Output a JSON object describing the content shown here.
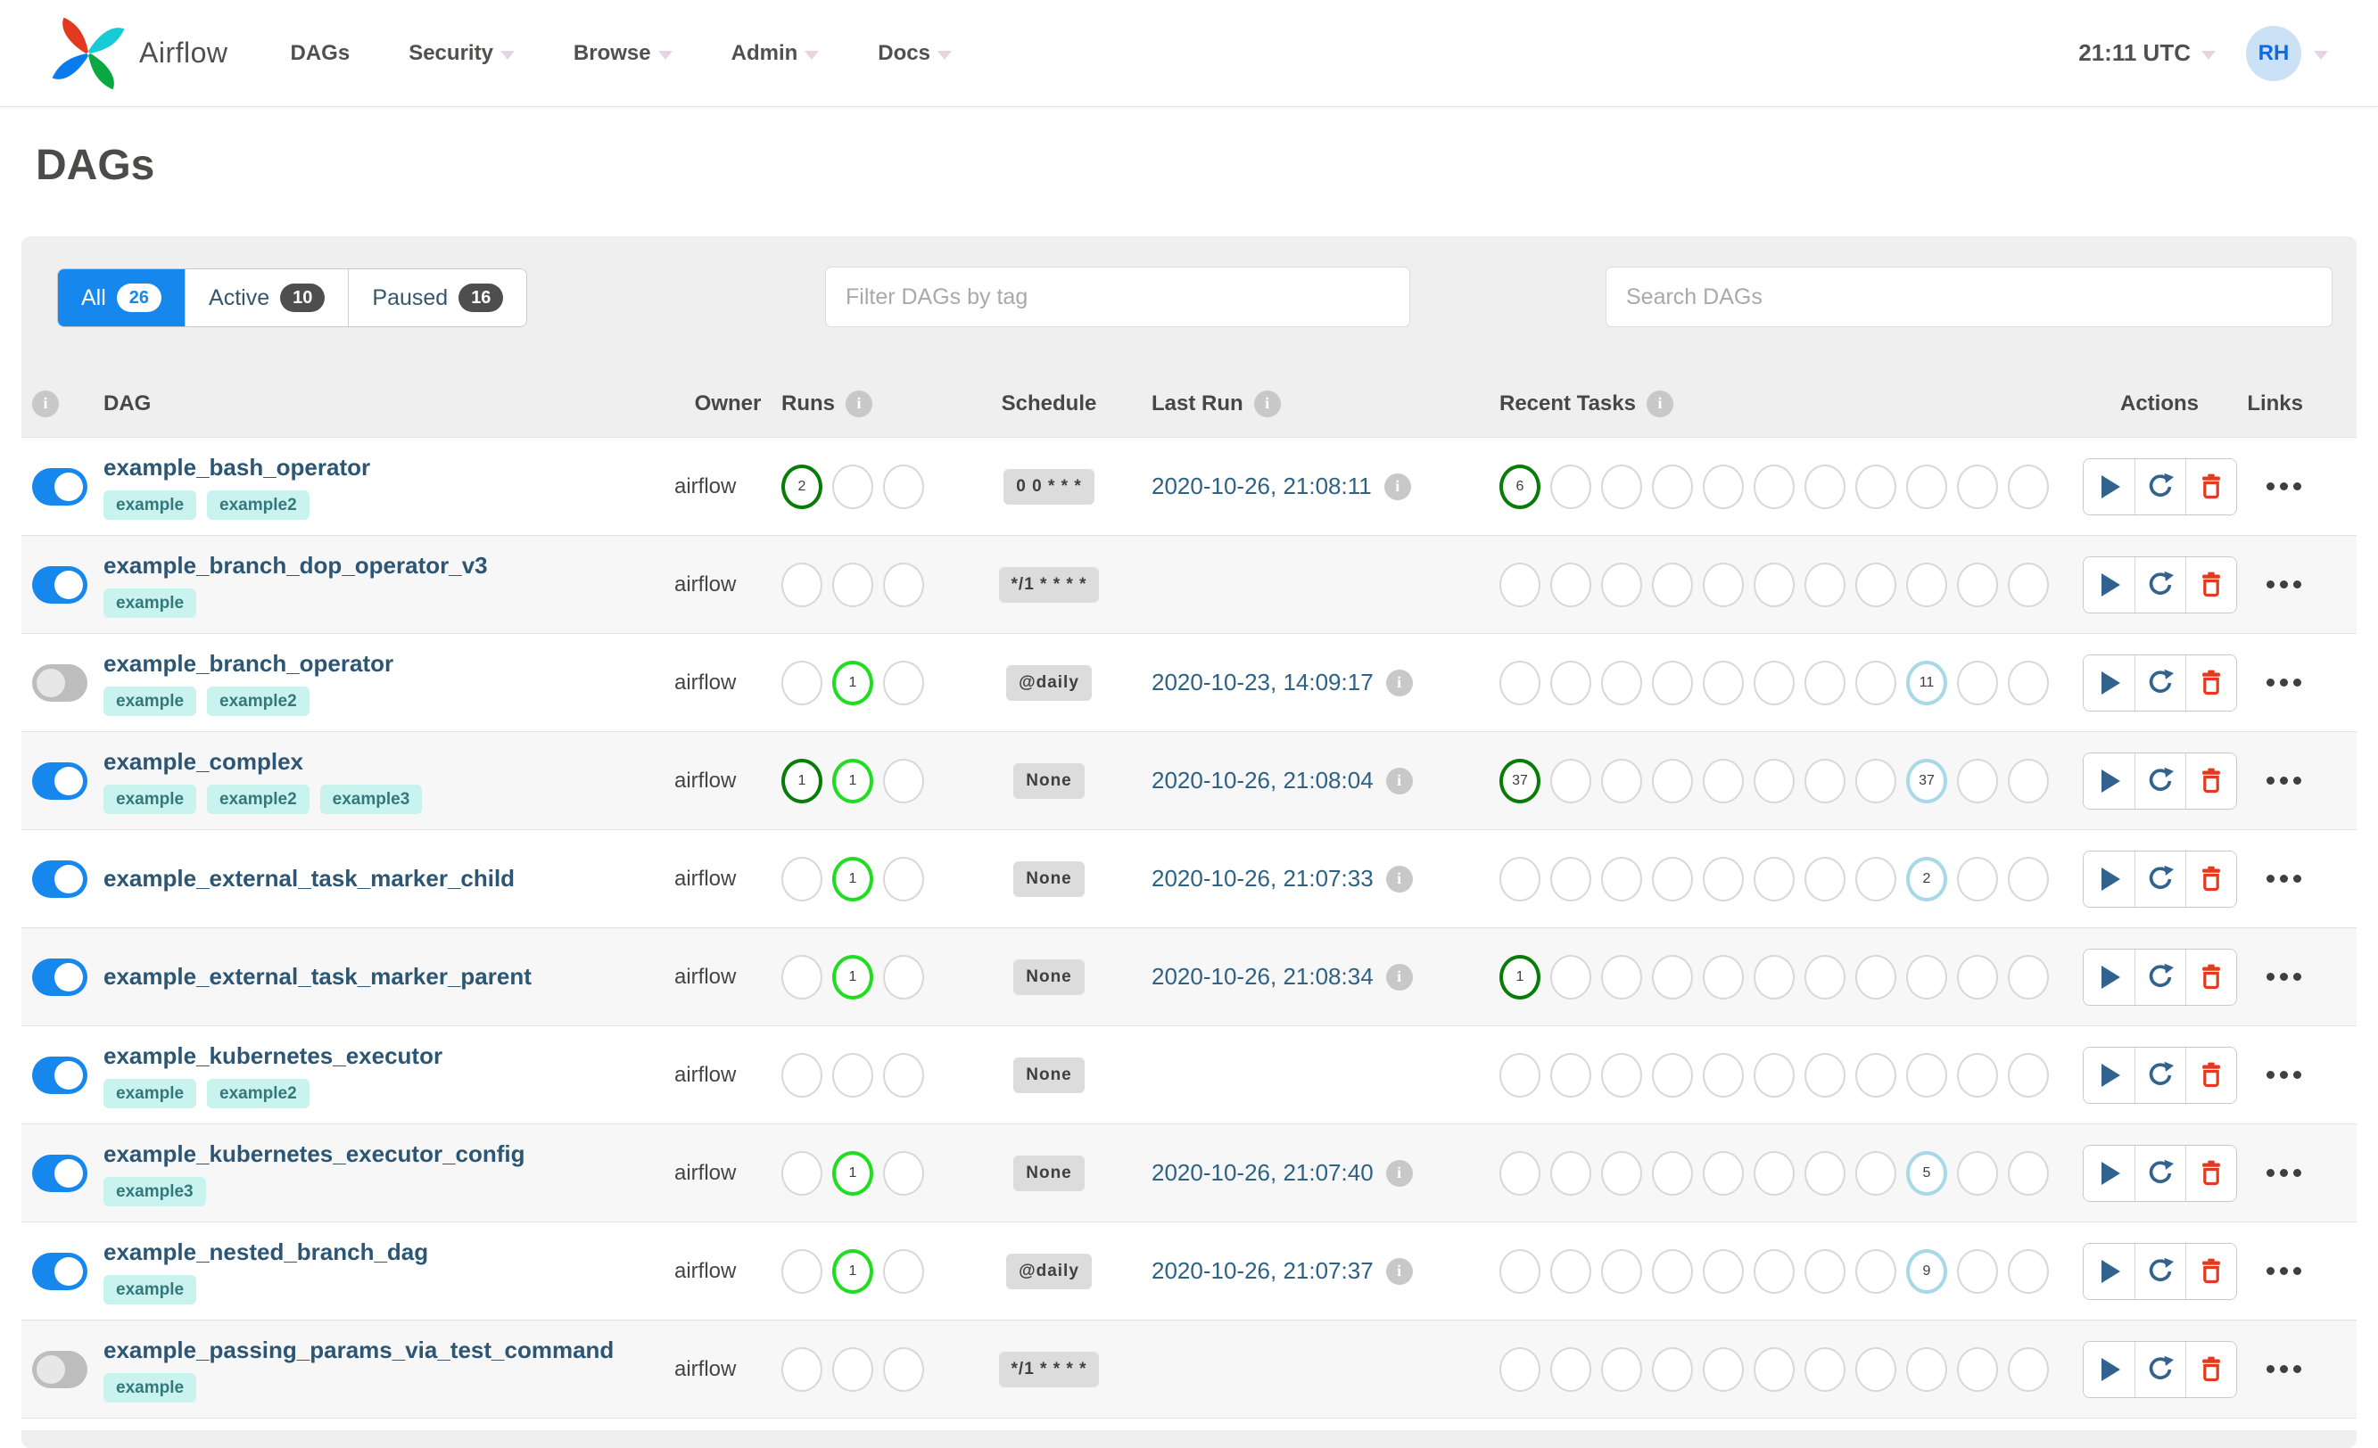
{
  "navbar": {
    "brand": "Airflow",
    "items": [
      {
        "label": "DAGs",
        "caret": false
      },
      {
        "label": "Security",
        "caret": true
      },
      {
        "label": "Browse",
        "caret": true
      },
      {
        "label": "Admin",
        "caret": true
      },
      {
        "label": "Docs",
        "caret": true
      }
    ],
    "clock": "21:11 UTC",
    "avatar_initials": "RH"
  },
  "page": {
    "title": "DAGs"
  },
  "filters": {
    "tabs": [
      {
        "label": "All",
        "count": "26",
        "active": true
      },
      {
        "label": "Active",
        "count": "10",
        "active": false
      },
      {
        "label": "Paused",
        "count": "16",
        "active": false
      }
    ],
    "tag_filter_placeholder": "Filter DAGs by tag",
    "search_placeholder": "Search DAGs"
  },
  "table": {
    "headers": {
      "dag": "DAG",
      "owner": "Owner",
      "runs": "Runs",
      "schedule": "Schedule",
      "last_run": "Last Run",
      "recent_tasks": "Recent Tasks",
      "actions": "Actions",
      "links": "Links"
    },
    "runs_slots": 3,
    "recent_slots": 11,
    "rows": [
      {
        "name": "example_bash_operator",
        "enabled": true,
        "tags": [
          "example",
          "example2"
        ],
        "owner": "airflow",
        "runs": [
          {
            "pos": 1,
            "state": "success",
            "count": "2"
          }
        ],
        "schedule": "0 0 * * *",
        "last_run": "2020-10-26, 21:08:11",
        "recent": [
          {
            "pos": 1,
            "state": "success",
            "count": "6"
          }
        ]
      },
      {
        "name": "example_branch_dop_operator_v3",
        "enabled": true,
        "tags": [
          "example"
        ],
        "owner": "airflow",
        "runs": [],
        "schedule": "*/1 * * * *",
        "last_run": "",
        "recent": []
      },
      {
        "name": "example_branch_operator",
        "enabled": false,
        "tags": [
          "example",
          "example2"
        ],
        "owner": "airflow",
        "runs": [
          {
            "pos": 2,
            "state": "running",
            "count": "1"
          }
        ],
        "schedule": "@daily",
        "last_run": "2020-10-23, 14:09:17",
        "recent": [
          {
            "pos": 9,
            "state": "none",
            "count": "11"
          }
        ]
      },
      {
        "name": "example_complex",
        "enabled": true,
        "tags": [
          "example",
          "example2",
          "example3"
        ],
        "owner": "airflow",
        "runs": [
          {
            "pos": 1,
            "state": "success",
            "count": "1"
          },
          {
            "pos": 2,
            "state": "running",
            "count": "1"
          }
        ],
        "schedule": "None",
        "last_run": "2020-10-26, 21:08:04",
        "recent": [
          {
            "pos": 1,
            "state": "success",
            "count": "37"
          },
          {
            "pos": 9,
            "state": "none",
            "count": "37"
          }
        ]
      },
      {
        "name": "example_external_task_marker_child",
        "enabled": true,
        "tags": [],
        "owner": "airflow",
        "runs": [
          {
            "pos": 2,
            "state": "running",
            "count": "1"
          }
        ],
        "schedule": "None",
        "last_run": "2020-10-26, 21:07:33",
        "recent": [
          {
            "pos": 9,
            "state": "none",
            "count": "2"
          }
        ]
      },
      {
        "name": "example_external_task_marker_parent",
        "enabled": true,
        "tags": [],
        "owner": "airflow",
        "runs": [
          {
            "pos": 2,
            "state": "running",
            "count": "1"
          }
        ],
        "schedule": "None",
        "last_run": "2020-10-26, 21:08:34",
        "recent": [
          {
            "pos": 1,
            "state": "success",
            "count": "1"
          }
        ]
      },
      {
        "name": "example_kubernetes_executor",
        "enabled": true,
        "tags": [
          "example",
          "example2"
        ],
        "owner": "airflow",
        "runs": [],
        "schedule": "None",
        "last_run": "",
        "recent": []
      },
      {
        "name": "example_kubernetes_executor_config",
        "enabled": true,
        "tags": [
          "example3"
        ],
        "owner": "airflow",
        "runs": [
          {
            "pos": 2,
            "state": "running",
            "count": "1"
          }
        ],
        "schedule": "None",
        "last_run": "2020-10-26, 21:07:40",
        "recent": [
          {
            "pos": 9,
            "state": "none",
            "count": "5"
          }
        ]
      },
      {
        "name": "example_nested_branch_dag",
        "enabled": true,
        "tags": [
          "example"
        ],
        "owner": "airflow",
        "runs": [
          {
            "pos": 2,
            "state": "running",
            "count": "1"
          }
        ],
        "schedule": "@daily",
        "last_run": "2020-10-26, 21:07:37",
        "recent": [
          {
            "pos": 9,
            "state": "none",
            "count": "9"
          }
        ]
      },
      {
        "name": "example_passing_params_via_test_command",
        "enabled": false,
        "tags": [
          "example"
        ],
        "owner": "airflow",
        "runs": [],
        "schedule": "*/1 * * * *",
        "last_run": "",
        "recent": []
      }
    ]
  },
  "colors": {
    "accent_blue": "#1687ec",
    "success_green": "#077c07",
    "running_lime": "#21dd21",
    "none_lightblue": "#a8d9e8",
    "tag_bg": "#c9f3ef",
    "tag_text": "#35787c",
    "link_blue": "#2d6285",
    "danger_red": "#e5391f",
    "action_blue": "#32628e"
  }
}
